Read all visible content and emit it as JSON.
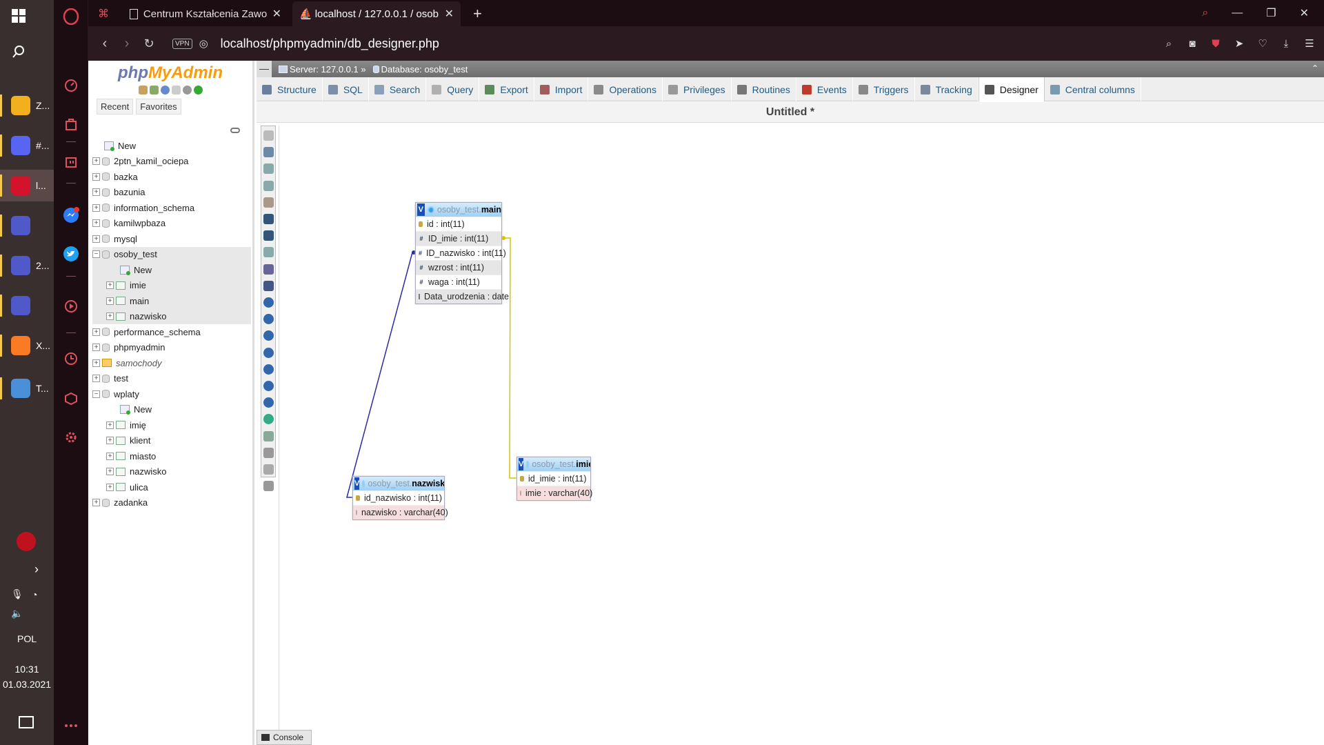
{
  "taskbar": {
    "apps": [
      {
        "label": "Z...",
        "icon": "folder-icon",
        "color": "#f2b01e"
      },
      {
        "label": "#...",
        "icon": "discord-icon",
        "color": "#5865f2"
      },
      {
        "label": "l...",
        "icon": "opera-icon",
        "color": "#d3122b"
      },
      {
        "label": "",
        "icon": "teams-icon",
        "color": "#5059c9"
      },
      {
        "label": "2...",
        "icon": "teams-icon",
        "color": "#5059c9"
      },
      {
        "label": "",
        "icon": "teams-icon",
        "color": "#5059c9"
      },
      {
        "label": "X...",
        "icon": "xampp-icon",
        "color": "#fb7a24"
      },
      {
        "label": "T...",
        "icon": "paint-icon",
        "color": "#4a90d9"
      }
    ],
    "language": "POL",
    "time": "10:31",
    "date": "01.03.2021"
  },
  "browser": {
    "tabs": [
      {
        "title": "Centrum Kształcenia Zawod",
        "icon": "page-icon"
      },
      {
        "title": "localhost / 127.0.0.1 / osob",
        "icon": "pma-icon"
      }
    ],
    "vpn_label": "VPN",
    "url": "localhost/phpmyadmin/db_designer.php"
  },
  "pma": {
    "logo_php": "php",
    "logo_myadmin": "MyAdmin",
    "nav_tabs": [
      "Recent",
      "Favorites"
    ],
    "tree": [
      {
        "label": "New",
        "level": 0,
        "type": "new"
      },
      {
        "label": "2ptn_kamil_ociepa",
        "level": 0,
        "type": "db"
      },
      {
        "label": "bazka",
        "level": 0,
        "type": "db"
      },
      {
        "label": "bazunia",
        "level": 0,
        "type": "db"
      },
      {
        "label": "information_schema",
        "level": 0,
        "type": "db"
      },
      {
        "label": "kamilwpbaza",
        "level": 0,
        "type": "db"
      },
      {
        "label": "mysql",
        "level": 0,
        "type": "db"
      },
      {
        "label": "osoby_test",
        "level": 0,
        "type": "db-open"
      },
      {
        "label": "New",
        "level": 1,
        "type": "new"
      },
      {
        "label": "imie",
        "level": 1,
        "type": "table"
      },
      {
        "label": "main",
        "level": 1,
        "type": "table"
      },
      {
        "label": "nazwisko",
        "level": 1,
        "type": "table"
      },
      {
        "label": "performance_schema",
        "level": 0,
        "type": "db"
      },
      {
        "label": "phpmyadmin",
        "level": 0,
        "type": "db"
      },
      {
        "label": "samochody",
        "level": 0,
        "type": "view"
      },
      {
        "label": "test",
        "level": 0,
        "type": "db"
      },
      {
        "label": "wplaty",
        "level": 0,
        "type": "db-open"
      },
      {
        "label": "New",
        "level": 1,
        "type": "new"
      },
      {
        "label": "imię",
        "level": 1,
        "type": "table"
      },
      {
        "label": "klient",
        "level": 1,
        "type": "table"
      },
      {
        "label": "miasto",
        "level": 1,
        "type": "table"
      },
      {
        "label": "nazwisko",
        "level": 1,
        "type": "table"
      },
      {
        "label": "ulica",
        "level": 1,
        "type": "table"
      },
      {
        "label": "zadanka",
        "level": 0,
        "type": "db"
      }
    ],
    "breadcrumb": {
      "server": "Server: 127.0.0.1 »",
      "database": "Database: osoby_test"
    },
    "menu": [
      {
        "label": "Structure",
        "icon": "structure-icon",
        "color": "#6a7fa0"
      },
      {
        "label": "SQL",
        "icon": "sql-icon",
        "color": "#7f8fa8"
      },
      {
        "label": "Search",
        "icon": "search-icon",
        "color": "#8aa0b8"
      },
      {
        "label": "Query",
        "icon": "query-icon",
        "color": "#b0b0b0"
      },
      {
        "label": "Export",
        "icon": "export-icon",
        "color": "#5b8a5b"
      },
      {
        "label": "Import",
        "icon": "import-icon",
        "color": "#a05b5b"
      },
      {
        "label": "Operations",
        "icon": "wrench-icon",
        "color": "#8a8a8a"
      },
      {
        "label": "Privileges",
        "icon": "privileges-icon",
        "color": "#999"
      },
      {
        "label": "Routines",
        "icon": "routines-icon",
        "color": "#777"
      },
      {
        "label": "Events",
        "icon": "clock-icon",
        "color": "#c0392b"
      },
      {
        "label": "Triggers",
        "icon": "triggers-icon",
        "color": "#888"
      },
      {
        "label": "Tracking",
        "icon": "eye-icon",
        "color": "#7a8a9a"
      },
      {
        "label": "Designer",
        "icon": "designer-icon",
        "color": "#555"
      },
      {
        "label": "Central columns",
        "icon": "central-columns-icon",
        "color": "#7a9ab0"
      }
    ],
    "active_menu": "Designer",
    "page_title": "Untitled *",
    "console_label": "Console"
  },
  "designer": {
    "tables": [
      {
        "db": "osoby_test.",
        "name": "main",
        "columns": [
          {
            "label": "id : int(11)",
            "kind": "key"
          },
          {
            "label": "ID_imie : int(11)",
            "kind": "num"
          },
          {
            "label": "ID_nazwisko : int(11)",
            "kind": "num"
          },
          {
            "label": "wzrost : int(11)",
            "kind": "num"
          },
          {
            "label": "waga : int(11)",
            "kind": "num"
          },
          {
            "label": "Data_urodzenia : date",
            "kind": "date"
          }
        ]
      },
      {
        "db": "osoby_test.",
        "name": "imie",
        "columns": [
          {
            "label": "id_imie : int(11)",
            "kind": "key"
          },
          {
            "label": "imie : varchar(40)",
            "kind": "txt"
          }
        ]
      },
      {
        "db": "osoby_test.",
        "name": "nazwisko",
        "columns": [
          {
            "label": "id_nazwisko : int(11)",
            "kind": "key"
          },
          {
            "label": "nazwisko : varchar(40)",
            "kind": "txt"
          }
        ]
      }
    ],
    "relations": [
      {
        "from": "main.ID_imie",
        "to": "imie.id_imie",
        "color": "#d4c400"
      },
      {
        "from": "main.ID_nazwisko",
        "to": "nazwisko.id_nazwisko",
        "color": "#2a2aa8"
      }
    ]
  }
}
